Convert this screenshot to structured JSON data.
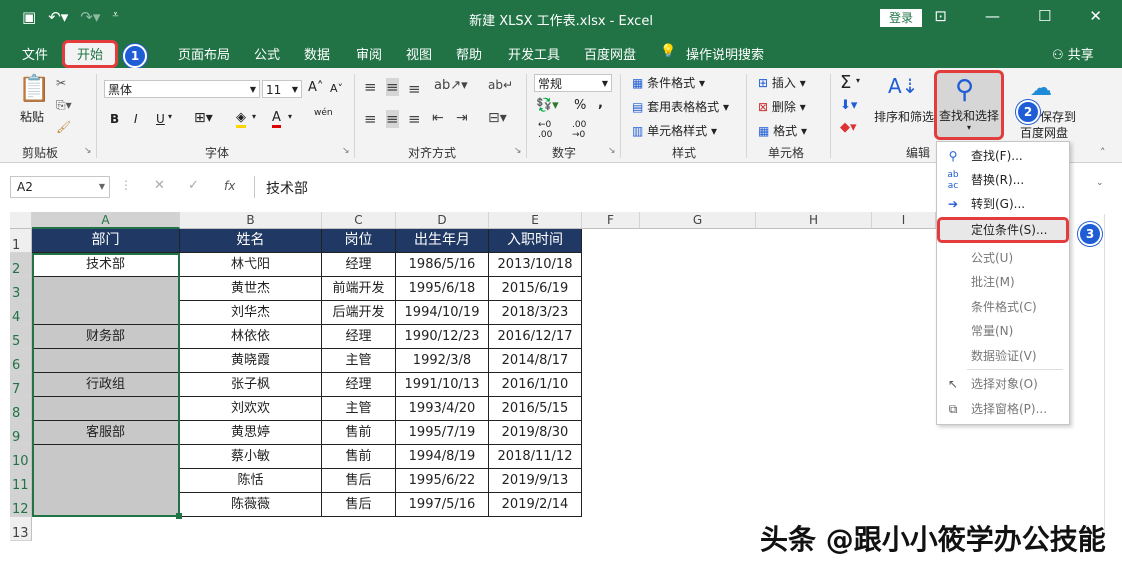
{
  "window": {
    "title": "新建 XLSX 工作表.xlsx - Excel",
    "login_label": "登录"
  },
  "tabs": [
    "文件",
    "开始",
    "页面布局",
    "公式",
    "数据",
    "审阅",
    "视图",
    "帮助",
    "开发工具",
    "百度网盘",
    "操作说明搜索"
  ],
  "share_label": "共享",
  "badges": [
    "1",
    "2",
    "3"
  ],
  "ribbon": {
    "clipboard": {
      "paste": "粘贴",
      "label": "剪贴板"
    },
    "font": {
      "name": "黑体",
      "size": "11",
      "bold": "B",
      "italic": "I",
      "underline": "U",
      "wen": "wén",
      "label": "字体"
    },
    "alignment": {
      "label": "对齐方式"
    },
    "number": {
      "format": "常规",
      "percent": "%",
      "comma": ",",
      "label": "数字"
    },
    "styles": {
      "cond": "条件格式",
      "table": "套用表格格式",
      "cell": "单元格样式",
      "label": "样式"
    },
    "cells": {
      "insert": "插入",
      "delete": "删除",
      "format": "格式",
      "label": "单元格"
    },
    "editing": {
      "sort": "排序和筛选",
      "find": "查找和选择",
      "label": "编辑"
    },
    "save": {
      "line1": "保存到",
      "line2": "百度网盘"
    }
  },
  "formula_bar": {
    "name_box": "A2",
    "fx": "fx",
    "content": "技术部"
  },
  "columns": [
    "A",
    "B",
    "C",
    "D",
    "E",
    "F",
    "G",
    "H",
    "I"
  ],
  "rows": [
    "1",
    "2",
    "3",
    "4",
    "5",
    "6",
    "7",
    "8",
    "9",
    "10",
    "11",
    "12",
    "13"
  ],
  "table": {
    "headers": [
      "部门",
      "姓名",
      "岗位",
      "出生年月",
      "入职时间"
    ],
    "rows": [
      [
        "技术部",
        "林弋阳",
        "经理",
        "1986/5/16",
        "2013/10/18"
      ],
      [
        "",
        "黄世杰",
        "前端开发",
        "1995/6/18",
        "2015/6/19"
      ],
      [
        "",
        "刘华杰",
        "后端开发",
        "1994/10/19",
        "2018/3/23"
      ],
      [
        "财务部",
        "林依依",
        "经理",
        "1990/12/23",
        "2016/12/17"
      ],
      [
        "",
        "黄晓霞",
        "主管",
        "1992/3/8",
        "2014/8/17"
      ],
      [
        "行政组",
        "张子枫",
        "经理",
        "1991/10/13",
        "2016/1/10"
      ],
      [
        "",
        "刘欢欢",
        "主管",
        "1993/4/20",
        "2016/5/15"
      ],
      [
        "客服部",
        "黄思婷",
        "售前",
        "1995/7/19",
        "2019/8/30"
      ],
      [
        "",
        "蔡小敏",
        "售前",
        "1994/8/19",
        "2018/11/12"
      ],
      [
        "",
        "陈恬",
        "售后",
        "1995/6/22",
        "2019/9/13"
      ],
      [
        "",
        "陈薇薇",
        "售后",
        "1997/5/16",
        "2019/2/14"
      ]
    ]
  },
  "menu": [
    {
      "icon": "search-icon",
      "label": "查找(F)..."
    },
    {
      "icon": "replace-icon",
      "label": "替换(R)..."
    },
    {
      "icon": "arrow-icon",
      "label": "转到(G)..."
    },
    {
      "icon": "",
      "label": "定位条件(S)..."
    },
    {
      "icon": "",
      "label": "公式(U)"
    },
    {
      "icon": "",
      "label": "批注(M)"
    },
    {
      "icon": "",
      "label": "条件格式(C)"
    },
    {
      "icon": "",
      "label": "常量(N)"
    },
    {
      "icon": "",
      "label": "数据验证(V)"
    },
    {
      "icon": "cursor-icon",
      "label": "选择对象(O)"
    },
    {
      "icon": "pane-icon",
      "label": "选择窗格(P)..."
    }
  ],
  "watermark": "头条 @跟小小筱学办公技能",
  "colors": {
    "excel_green": "#217346",
    "header_navy": "#1f3864",
    "highlight_red": "#e23c3c",
    "badge_blue": "#1f5dd6",
    "selected_gray": "#c8c8c8"
  }
}
